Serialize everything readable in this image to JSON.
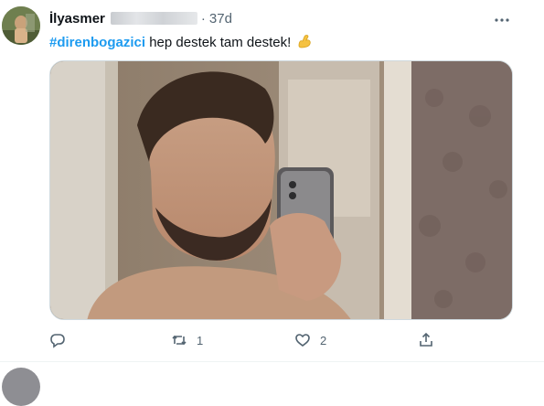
{
  "tweet": {
    "author_name": "İlyasmer",
    "dot": "·",
    "time": "37d",
    "hashtag": "#direnbogazici",
    "text": " hep destek tam destek!",
    "emoji": "flexed-biceps-emoji",
    "reply_count": "",
    "retweet_count": "1",
    "like_count": "2",
    "share_count": ""
  },
  "icons": {
    "more": "more-horizontal-icon",
    "reply": "reply-icon",
    "retweet": "retweet-icon",
    "like": "heart-icon",
    "share": "share-icon"
  },
  "colors": {
    "hashtag": "#1d9bf0",
    "secondary_text": "#536471",
    "border": "#cfd9de"
  }
}
